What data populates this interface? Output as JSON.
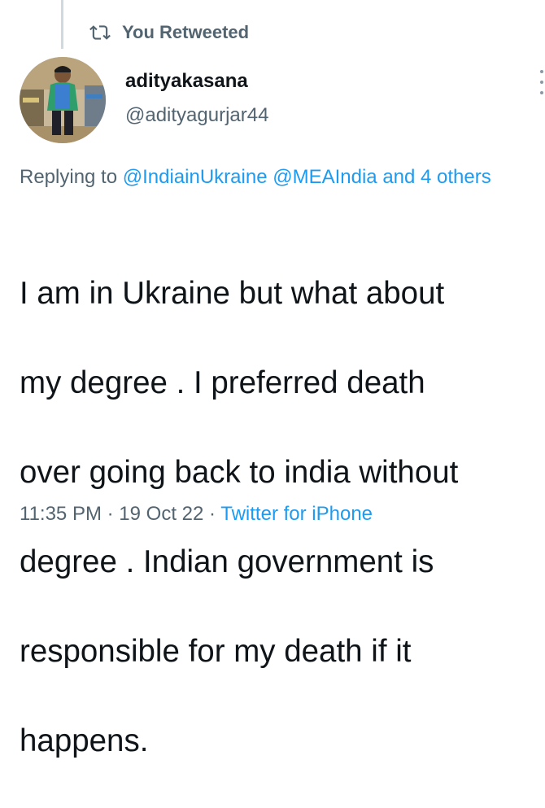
{
  "retweet": {
    "icon": "retweet-icon",
    "label": "You Retweeted"
  },
  "author": {
    "display_name": "adityakasana",
    "handle": "@adityagurjar44",
    "avatar_icon": "user-avatar"
  },
  "reply_context": {
    "prefix": "Replying to",
    "mentions": [
      "@IndiainUkraine",
      "@MEAIndia"
    ],
    "others": "and 4 others"
  },
  "tweet": {
    "lines": [
      "I am in Ukraine but what about",
      "my degree . I preferred death",
      "over going back to india without",
      "degree . Indian government is",
      "responsible for my death if it",
      "happens."
    ]
  },
  "meta": {
    "time": "11:35 PM",
    "sep1": "·",
    "date": "19 Oct 22",
    "sep2": "·",
    "source": "Twitter for iPhone"
  },
  "colors": {
    "link": "#1d9bf0",
    "muted": "#536471",
    "text": "#0f1419"
  }
}
